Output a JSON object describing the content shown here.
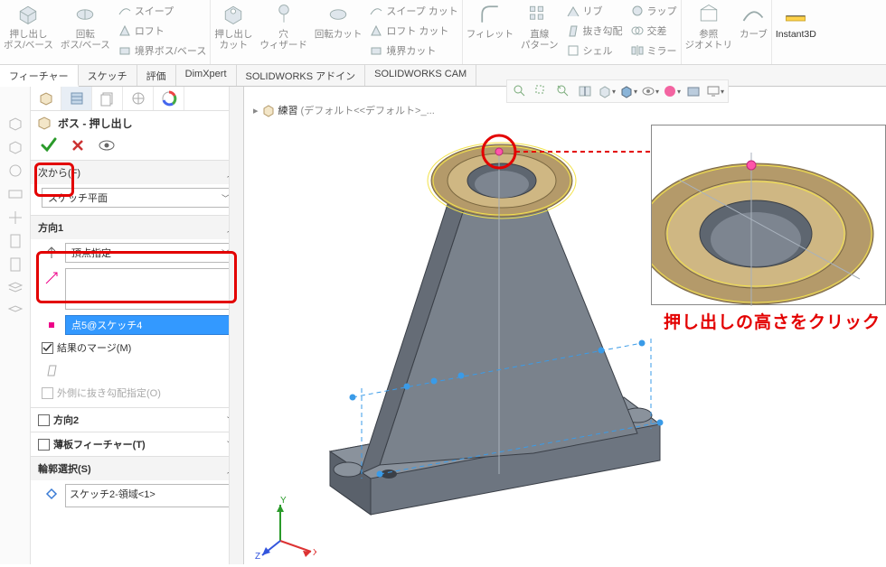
{
  "ribbon": {
    "extrude_boss": "押し出し\nボス/ベース",
    "revolve_boss": "回転\nボス/ベース",
    "sweep": "スイープ",
    "loft": "ロフト",
    "boundary": "境界ボス/ベース",
    "extrude_cut": "押し出し\nカット",
    "hole_wizard": "穴\nウィザード",
    "revolve_cut": "回転カット",
    "sweep_cut": "スイープ カット",
    "loft_cut": "ロフト カット",
    "boundary_cut": "境界カット",
    "fillet": "フィレット",
    "linear_pattern": "直線\nパターン",
    "rib": "リブ",
    "draft": "抜き勾配",
    "shell": "シェル",
    "wrap": "ラップ",
    "intersect": "交差",
    "mirror": "ミラー",
    "ref_geom": "参照\nジオメトリ",
    "curve": "カーブ",
    "instant3d": "Instant3D"
  },
  "tabs": {
    "feature": "フィーチャー",
    "sketch": "スケッチ",
    "evaluate": "評価",
    "dimxpert": "DimXpert",
    "addin": "SOLIDWORKS アドイン",
    "cam": "SOLIDWORKS CAM"
  },
  "doc": {
    "name": "練習",
    "suffix": "(デフォルト<<デフォルト>_..."
  },
  "panel": {
    "title": "ボス - 押し出し",
    "from": "次から(F)",
    "from_value": "スケッチ平面",
    "dir1": "方向1",
    "dir1_value": "頂点指定",
    "vertex_selected": "点5@スケッチ4",
    "merge": "結果のマージ(M)",
    "draft_out": "外側に抜き勾配指定(O)",
    "dir2": "方向2",
    "thin": "薄板フィーチャー(T)",
    "contour": "輪郭選択(S)",
    "contour_value": "スケッチ2-領域<1>"
  },
  "annotation": "押し出しの高さをクリック"
}
